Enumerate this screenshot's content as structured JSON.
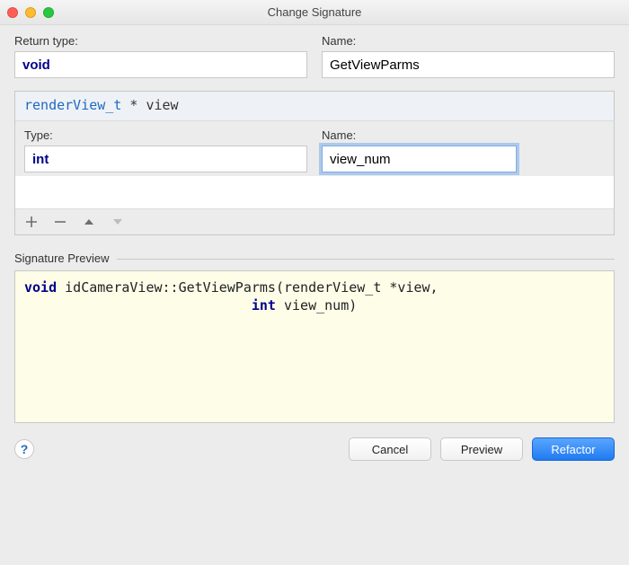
{
  "window": {
    "title": "Change Signature"
  },
  "returnType": {
    "label": "Return type:",
    "value": "void"
  },
  "name": {
    "label": "Name:",
    "value": "GetViewParms"
  },
  "paramHeader": {
    "type": "renderView_t",
    "star": "*",
    "ident": "view"
  },
  "paramEdit": {
    "typeLabel": "Type:",
    "typeValue": "int",
    "nameLabel": "Name:",
    "nameValue": "view_num"
  },
  "toolbar": {
    "addIcon": "plus-icon",
    "removeIcon": "minus-icon",
    "upIcon": "arrow-up-icon",
    "downIcon": "arrow-down-icon"
  },
  "previewSection": {
    "label": "Signature Preview"
  },
  "preview": {
    "line1_kw": "void",
    "line1_rest": " idCameraView::GetViewParms(renderView_t *view,",
    "line2_pad": "                            ",
    "line2_kw": "int",
    "line2_rest": " view_num)"
  },
  "buttons": {
    "help": "?",
    "cancel": "Cancel",
    "preview": "Preview",
    "refactor": "Refactor"
  }
}
